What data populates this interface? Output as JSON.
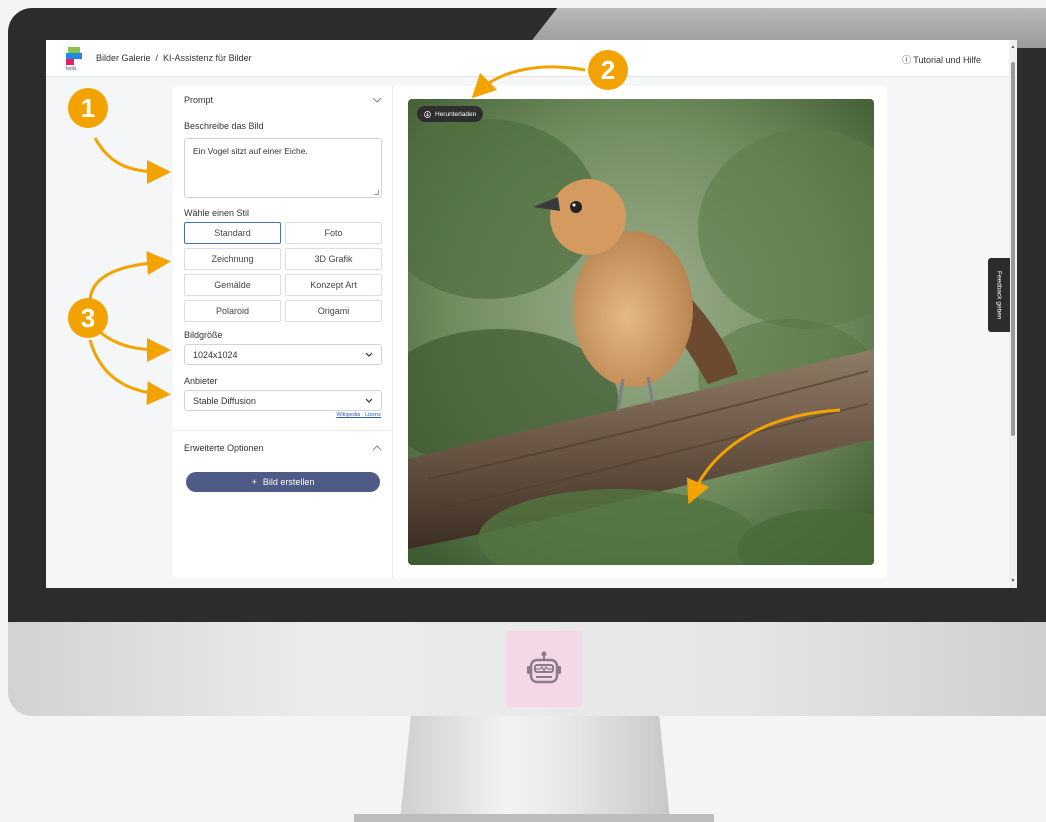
{
  "app": {
    "logo_label": "tools",
    "breadcrumb": [
      "Bilder Galerie",
      "/",
      "KI-Assistenz für Bilder"
    ],
    "help_label": "Tutorial und Hilfe"
  },
  "prompt_section": {
    "title": "Prompt",
    "describe_label": "Beschreibe das Bild",
    "prompt_value": "Ein Vogel sitzt auf einer Eiche."
  },
  "style_section": {
    "label": "Wähle einen Stil",
    "options": [
      "Standard",
      "Foto",
      "Zeichnung",
      "3D Grafik",
      "Gemälde",
      "Konzept Art",
      "Polaroid",
      "Origami"
    ],
    "selected": "Standard"
  },
  "size_section": {
    "label": "Bildgröße",
    "value": "1024x1024"
  },
  "provider_section": {
    "label": "Anbieter",
    "value": "Stable Diffusion",
    "link_wikipedia": "Wikipedia",
    "link_separator": "·",
    "link_license": "Lizenz"
  },
  "advanced": {
    "title": "Erweiterte Optionen"
  },
  "create_button": {
    "label": "Bild erstellen"
  },
  "image": {
    "download_label": "Herunterladen"
  },
  "feedback": {
    "label": "Feedback geben"
  },
  "callouts": [
    "1",
    "2",
    "3"
  ],
  "colors": {
    "accent_orange": "#f3a300",
    "primary_button": "#4f5a87",
    "active_style_border": "#4a6fa5"
  }
}
